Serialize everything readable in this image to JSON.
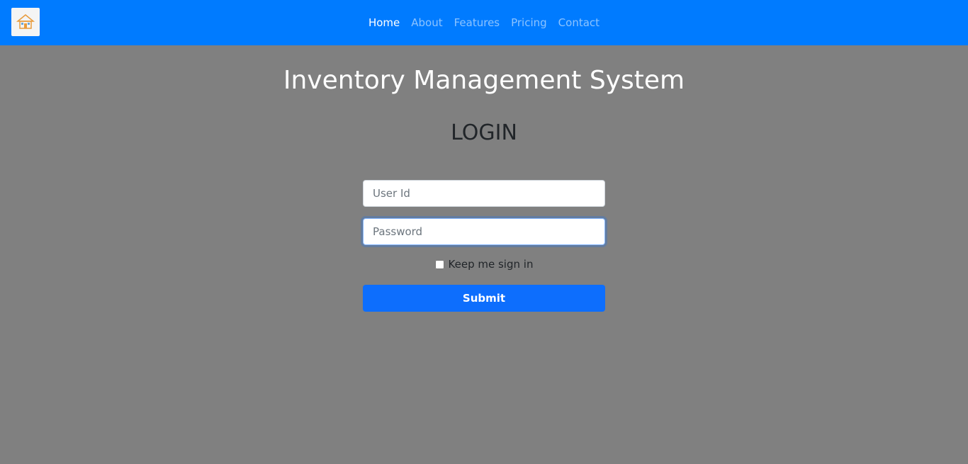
{
  "navbar": {
    "logo_icon": "house-logo-icon",
    "links": [
      {
        "label": "Home",
        "active": true
      },
      {
        "label": "About",
        "active": false
      },
      {
        "label": "Features",
        "active": false
      },
      {
        "label": "Pricing",
        "active": false
      },
      {
        "label": "Contact",
        "active": false
      }
    ]
  },
  "page": {
    "title": "Inventory Management System",
    "login_heading": "LOGIN"
  },
  "form": {
    "userid_placeholder": "User Id",
    "userid_value": "",
    "password_placeholder": "Password",
    "password_value": "",
    "remember_label": "Keep me sign in",
    "remember_checked": false,
    "submit_label": "Submit"
  },
  "colors": {
    "navbar": "#007bff",
    "background": "#808080",
    "submit": "#0d6efd"
  }
}
